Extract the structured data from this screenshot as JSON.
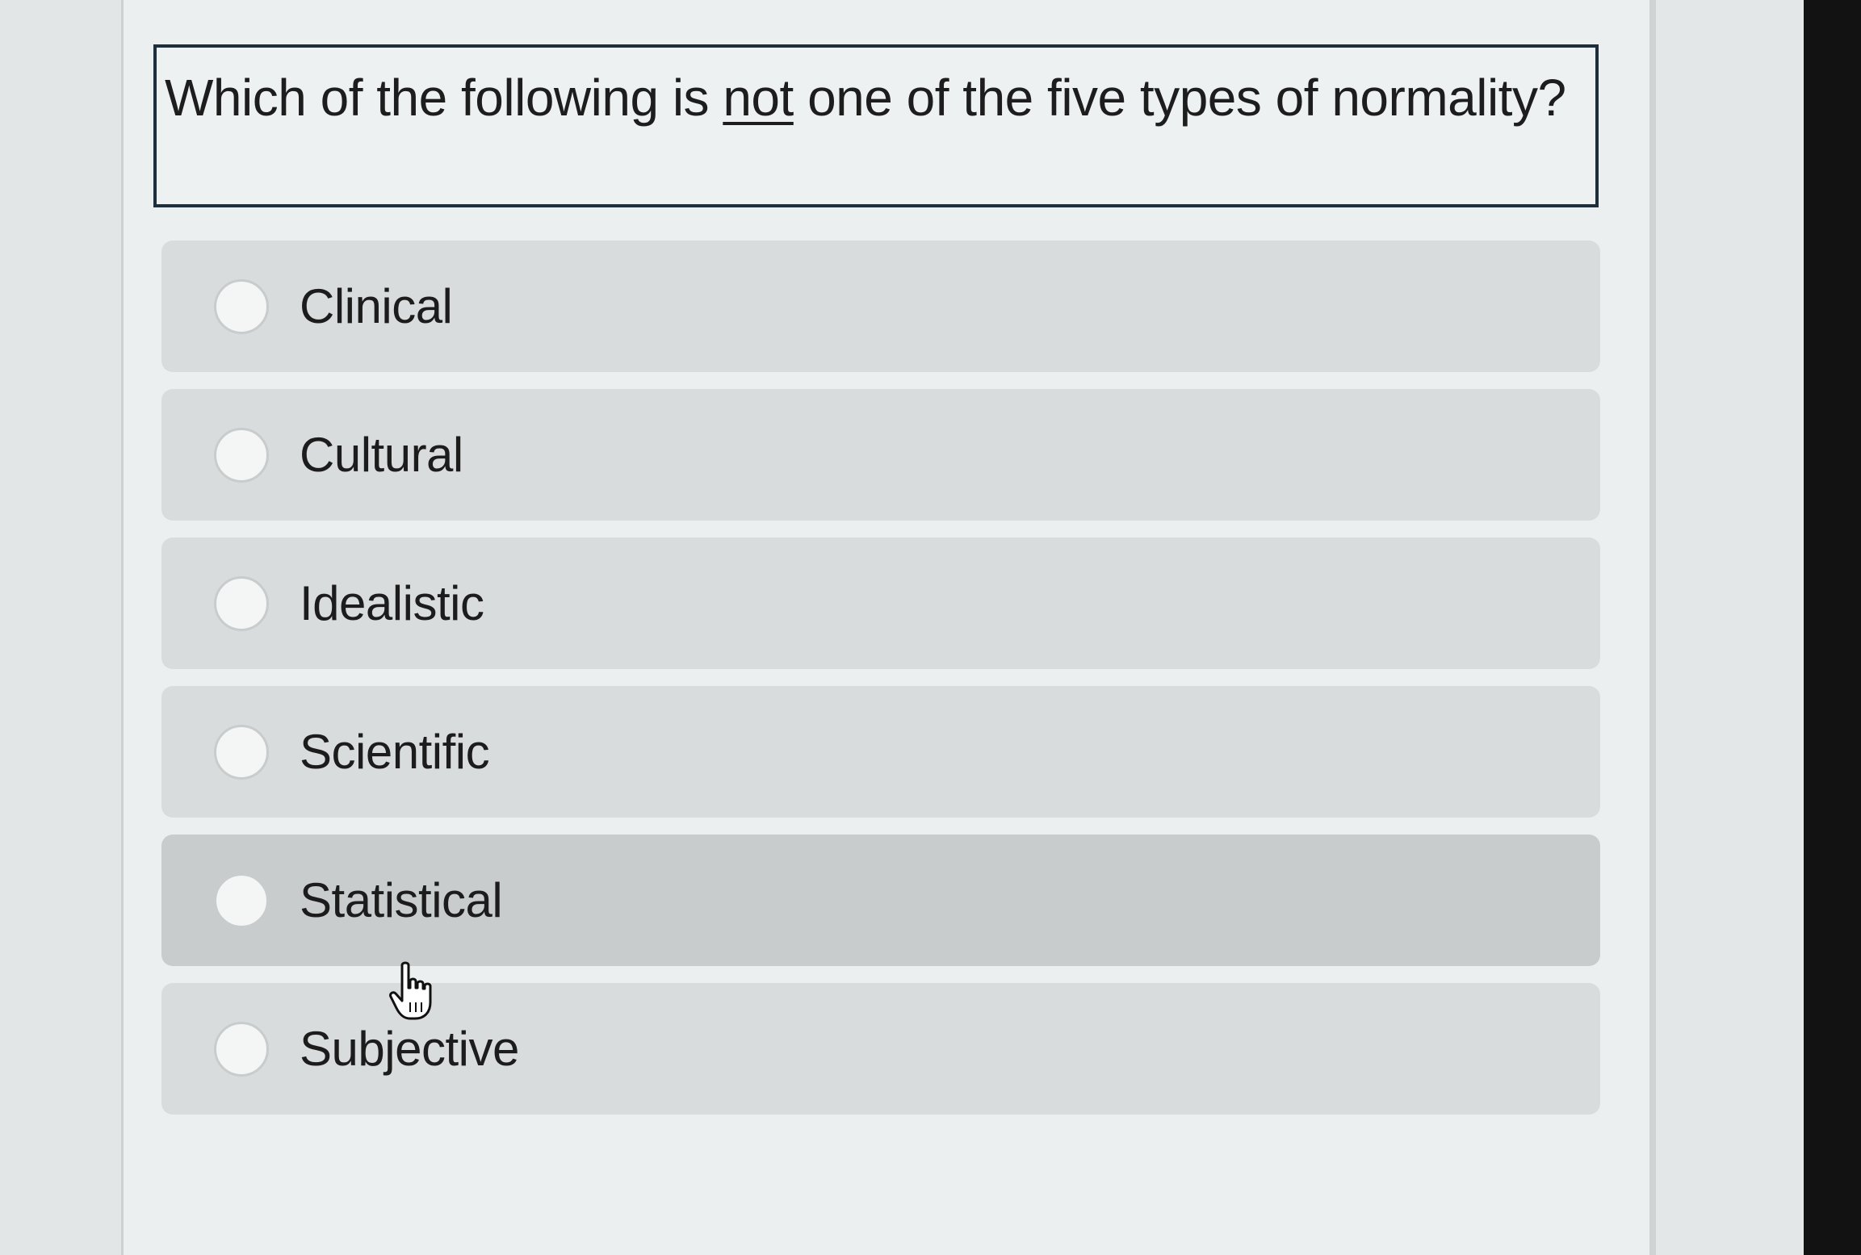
{
  "question": {
    "prefix": "Which of the following is ",
    "emphasis": "not",
    "suffix": " one of the five types of normality?"
  },
  "options": [
    {
      "label": "Clinical",
      "selected": false
    },
    {
      "label": "Cultural",
      "selected": false
    },
    {
      "label": "Idealistic",
      "selected": false
    },
    {
      "label": "Scientific",
      "selected": false
    },
    {
      "label": "Statistical",
      "selected": false
    },
    {
      "label": "Subjective",
      "selected": false
    }
  ],
  "icons": {
    "radio": "radio-circle",
    "cursor": "hand-pointer-cursor"
  },
  "colors": {
    "option_background": "#d9dcdc",
    "option_hover_background": "#c9cccc",
    "question_border": "#1f2e3d",
    "text": "#1d1d1d"
  }
}
